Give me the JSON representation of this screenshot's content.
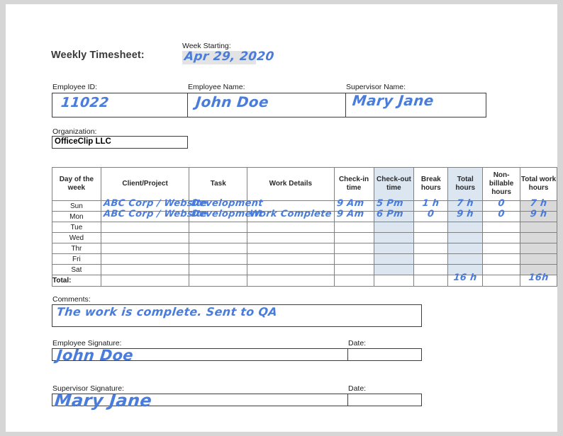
{
  "document": {
    "title": "Weekly Timesheet:",
    "week_starting_label": "Week Starting:",
    "week_starting_value": "Apr 29, 2020",
    "organization_label": "Organization:",
    "organization_value": "OfficeClip LLC"
  },
  "identity": {
    "employee_id_label": "Employee ID:",
    "employee_id_value": "11022",
    "employee_name_label": "Employee Name:",
    "employee_name_value": "John Doe",
    "supervisor_name_label": "Supervisor Name:",
    "supervisor_name_value": "Mary Jane"
  },
  "table": {
    "headers": [
      "Day of the week",
      "Client/Project",
      "Task",
      "Work Details",
      "Check-in time",
      "Check-out time",
      "Break hours",
      "Total hours",
      "Non-billable hours",
      "Total work hours"
    ],
    "rows": [
      {
        "day": "Sun",
        "client_project": "ABC Corp / Website",
        "task": "Development",
        "work_details": "",
        "check_in": "9 Am",
        "check_out": "5 Pm",
        "break_hours": "1 h",
        "total_hours": "7 h",
        "non_billable": "0",
        "total_work": "7 h"
      },
      {
        "day": "Mon",
        "client_project": "ABC Corp / Website",
        "task": "Development",
        "work_details": "Work Complete",
        "check_in": "9 Am",
        "check_out": "6 Pm",
        "break_hours": "0",
        "total_hours": "9 h",
        "non_billable": "0",
        "total_work": "9 h"
      },
      {
        "day": "Tue",
        "client_project": "",
        "task": "",
        "work_details": "",
        "check_in": "",
        "check_out": "",
        "break_hours": "",
        "total_hours": "",
        "non_billable": "",
        "total_work": ""
      },
      {
        "day": "Wed",
        "client_project": "",
        "task": "",
        "work_details": "",
        "check_in": "",
        "check_out": "",
        "break_hours": "",
        "total_hours": "",
        "non_billable": "",
        "total_work": ""
      },
      {
        "day": "Thr",
        "client_project": "",
        "task": "",
        "work_details": "",
        "check_in": "",
        "check_out": "",
        "break_hours": "",
        "total_hours": "",
        "non_billable": "",
        "total_work": ""
      },
      {
        "day": "Fri",
        "client_project": "",
        "task": "",
        "work_details": "",
        "check_in": "",
        "check_out": "",
        "break_hours": "",
        "total_hours": "",
        "non_billable": "",
        "total_work": ""
      },
      {
        "day": "Sat",
        "client_project": "",
        "task": "",
        "work_details": "",
        "check_in": "",
        "check_out": "",
        "break_hours": "",
        "total_hours": "",
        "non_billable": "",
        "total_work": ""
      }
    ],
    "total_row": {
      "label": "Total:",
      "total_hours": "16 h",
      "non_billable": "",
      "total_work": "16h"
    }
  },
  "comments": {
    "label": "Comments:",
    "value": "The work is complete. Sent to QA"
  },
  "signatures": {
    "employee_signature_label": "Employee Signature:",
    "employee_signature_value": "John Doe",
    "employee_date_label": "Date:",
    "employee_date_value": "",
    "supervisor_signature_label": "Supervisor Signature:",
    "supervisor_signature_value": "Mary Jane",
    "supervisor_date_label": "Date:",
    "supervisor_date_value": ""
  },
  "colors": {
    "highlight_blue": "#dce6f1",
    "highlight_gray": "#d9d9d9",
    "ink_blue": "#4a7ddb",
    "page_background": "#d6d6d6"
  }
}
